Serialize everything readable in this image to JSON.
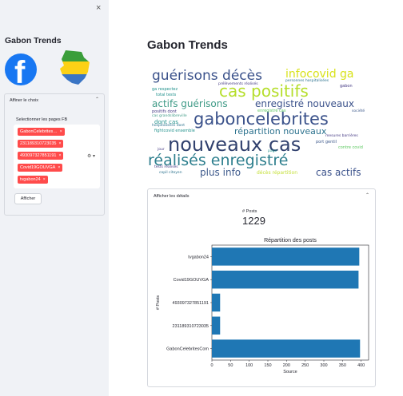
{
  "sidebar": {
    "close_glyph": "×",
    "title": "Gabon Trends",
    "facebook_letter": "f",
    "expander_label": "Affiner le choix",
    "expander_chevron": "⌃",
    "multiselect_label": "Selectionner les pages FB",
    "selected_pages": [
      {
        "label": "GabonCelebrites…",
        "remove": "×"
      },
      {
        "label": "231189310723035",
        "remove": "×"
      },
      {
        "label": "493097327851191",
        "remove": "×"
      },
      {
        "label": "Covid19GOUVGA",
        "remove": "×"
      },
      {
        "label": "tvgabon24",
        "remove": "×"
      }
    ],
    "multiselect_controls": "⚙ ▾",
    "submit_label": "Afficher"
  },
  "main": {
    "title": "Gabon Trends",
    "wordcloud_words": [
      {
        "text": "guérisons décès",
        "color": "#3b528b"
      },
      {
        "text": "infocovid ga",
        "color": "#d8e219"
      },
      {
        "text": "cas positifs",
        "color": "#b5de2b"
      },
      {
        "text": "actifs guérisons",
        "color": "#3e9a86"
      },
      {
        "text": "enregistré nouveaux",
        "color": "#3b528b"
      },
      {
        "text": "gaboncelebrites",
        "color": "#3b528b"
      },
      {
        "text": "répartition nouveaux",
        "color": "#2c728e"
      },
      {
        "text": "nouveaux cas",
        "color": "#31416e"
      },
      {
        "text": "réalisés enregistré",
        "color": "#2e7f8e"
      },
      {
        "text": "plus info",
        "color": "#3e5a8c"
      },
      {
        "text": "cas actifs",
        "color": "#3b528b"
      },
      {
        "text": "dont cas",
        "color": "#21918c"
      },
      {
        "text": "décès répartition",
        "color": "#c4df35"
      },
      {
        "text": "prélèvements réalisés",
        "color": "#443983"
      },
      {
        "text": "personnes hospitalisées",
        "color": "#2c728e"
      },
      {
        "text": "total tests",
        "color": "#21918c"
      },
      {
        "text": "ga respectez",
        "color": "#21918c"
      },
      {
        "text": "positifs dont",
        "color": "#443983"
      },
      {
        "text": "fightcovid ensemble",
        "color": "#21918c"
      },
      {
        "text": "tests réalisés",
        "color": "#443983"
      },
      {
        "text": "copil citoyen",
        "color": "#2c728e"
      },
      {
        "text": "port gentil",
        "color": "#3e5a8c"
      },
      {
        "text": "contre covid",
        "color": "#5ec962"
      },
      {
        "text": "mesures barrières",
        "color": "#443983"
      },
      {
        "text": "société",
        "color": "#3e5a8c"
      },
      {
        "text": "gabon",
        "color": "#443983"
      },
      {
        "text": "enregistré cas",
        "color": "#5ec962"
      },
      {
        "text": "hospitalisées dont",
        "color": "#2c728e"
      },
      {
        "text": "cas grandslibreville",
        "color": "#3e9a86"
      },
      {
        "text": "jour",
        "color": "#443983"
      },
      {
        "text": "page",
        "color": "#21918c"
      }
    ],
    "details_label": "Afficher les détails",
    "details_chevron": "⌃",
    "metric_label": "# Posts",
    "metric_value": "1229"
  },
  "chart_data": {
    "type": "bar",
    "orientation": "horizontal",
    "title": "Répartition des posts",
    "xlabel": "Source",
    "ylabel": "# Posts",
    "categories": [
      "tvgabon24",
      "Covid19GOUVGA",
      "493097327851191",
      "231189310723035",
      "GabonCelebritesCom"
    ],
    "values": [
      395,
      393,
      22,
      22,
      397
    ],
    "xlim": [
      0,
      420
    ],
    "xticks": [
      0,
      50,
      100,
      150,
      200,
      250,
      300,
      350,
      400
    ],
    "bar_color": "#1f77b4"
  }
}
